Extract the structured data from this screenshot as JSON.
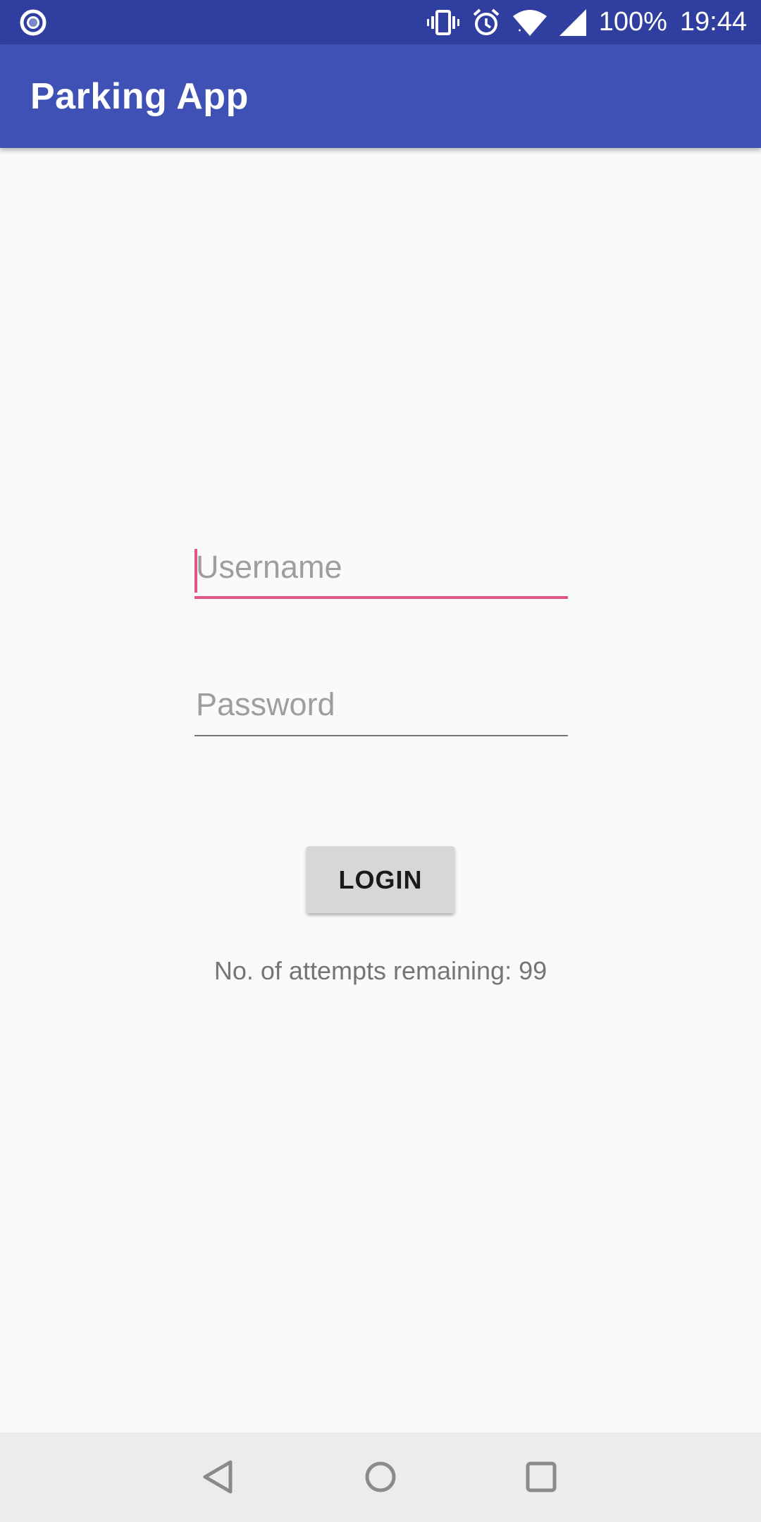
{
  "status_bar": {
    "battery": "100%",
    "time": "19:44",
    "icons": [
      "record-icon",
      "vibrate-icon",
      "alarm-icon",
      "wifi-icon",
      "signal-icon"
    ]
  },
  "app_bar": {
    "title": "Parking App"
  },
  "form": {
    "username": {
      "value": "",
      "placeholder": "Username"
    },
    "password": {
      "value": "",
      "placeholder": "Password"
    },
    "login_label": "LOGIN",
    "attempts_text": "No. of attempts remaining: 99"
  },
  "nav_bar": {
    "icons": [
      "back-icon",
      "home-icon",
      "recents-icon"
    ]
  },
  "colors": {
    "status_bar": "#303f9f",
    "app_bar": "#3f51b5",
    "accent": "#e0558b",
    "button": "#d6d7d7"
  }
}
